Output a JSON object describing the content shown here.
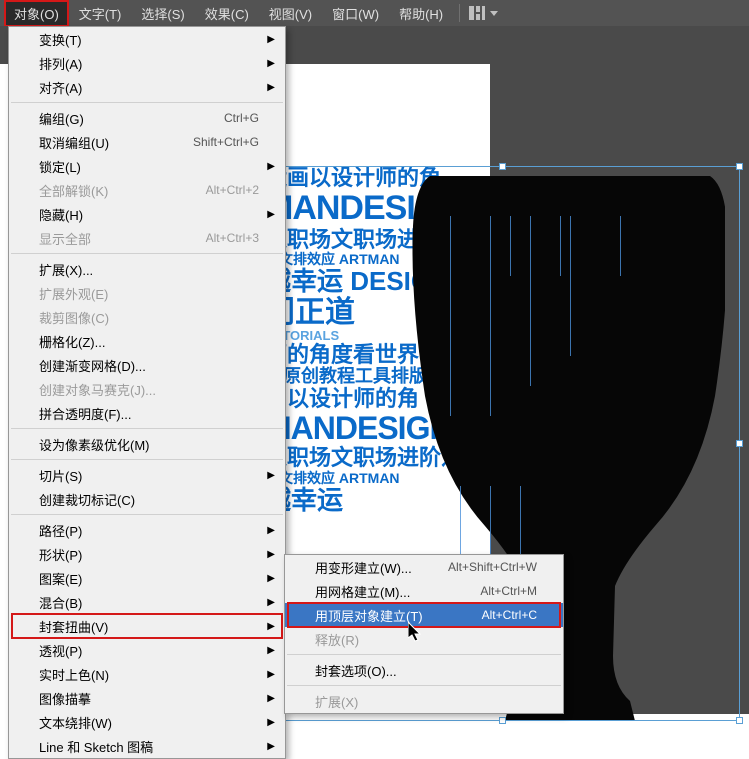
{
  "menubar": {
    "items": [
      "对象(O)",
      "文字(T)",
      "选择(S)",
      "效果(C)",
      "视图(V)",
      "窗口(W)",
      "帮助(H)"
    ]
  },
  "dropdown": {
    "groups": [
      [
        {
          "label": "变换(T)",
          "arrow": true
        },
        {
          "label": "排列(A)",
          "arrow": true
        },
        {
          "label": "对齐(A)",
          "arrow": true
        }
      ],
      [
        {
          "label": "编组(G)",
          "shortcut": "Ctrl+G"
        },
        {
          "label": "取消编组(U)",
          "shortcut": "Shift+Ctrl+G"
        },
        {
          "label": "锁定(L)",
          "arrow": true
        },
        {
          "label": "全部解锁(K)",
          "shortcut": "Alt+Ctrl+2",
          "disabled": true
        },
        {
          "label": "隐藏(H)",
          "arrow": true
        },
        {
          "label": "显示全部",
          "shortcut": "Alt+Ctrl+3",
          "disabled": true
        }
      ],
      [
        {
          "label": "扩展(X)..."
        },
        {
          "label": "扩展外观(E)",
          "disabled": true
        },
        {
          "label": "裁剪图像(C)",
          "disabled": true
        },
        {
          "label": "栅格化(Z)..."
        },
        {
          "label": "创建渐变网格(D)..."
        },
        {
          "label": "创建对象马赛克(J)...",
          "disabled": true
        },
        {
          "label": "拼合透明度(F)..."
        }
      ],
      [
        {
          "label": "设为像素级优化(M)"
        }
      ],
      [
        {
          "label": "切片(S)",
          "arrow": true
        },
        {
          "label": "创建裁切标记(C)"
        }
      ],
      [
        {
          "label": "路径(P)",
          "arrow": true
        },
        {
          "label": "形状(P)",
          "arrow": true
        },
        {
          "label": "图案(E)",
          "arrow": true
        },
        {
          "label": "混合(B)",
          "arrow": true
        },
        {
          "label": "封套扭曲(V)",
          "arrow": true,
          "boxed": true
        },
        {
          "label": "透视(P)",
          "arrow": true
        },
        {
          "label": "实时上色(N)",
          "arrow": true
        },
        {
          "label": "图像描摹",
          "arrow": true
        },
        {
          "label": "文本绕排(W)",
          "arrow": true
        },
        {
          "label": "Line 和 Sketch 图稿",
          "arrow": true
        }
      ]
    ]
  },
  "submenu": {
    "items": [
      {
        "label": "用变形建立(W)...",
        "shortcut": "Alt+Shift+Ctrl+W"
      },
      {
        "label": "用网格建立(M)...",
        "shortcut": "Alt+Ctrl+M"
      },
      {
        "label": "用顶层对象建立(T)",
        "shortcut": "Alt+Ctrl+C",
        "highlighted": true,
        "boxed": true
      },
      {
        "label": "释放(R)",
        "disabled": true
      },
      {
        "sep": true
      },
      {
        "label": "封套选项(O)..."
      },
      {
        "sep": true
      },
      {
        "label": "扩展(X)",
        "disabled": true
      }
    ]
  },
  "canvas_text": {
    "l1": "运画以设计师的角",
    "l2": "MANDESI",
    "l3": "入职场文职场进阶",
    "l4": "版文排效应 ARTMAN",
    "l5": "越幸运 DESIGN",
    "l6": "门正道",
    "l7": "TUTORIALS",
    "l8": "师的角度看世界",
    "l9": "运原创教程工具排版",
    "l10": "画以设计师的角",
    "l11": "MANDESIGN",
    "l12": "入职场文职场进阶之",
    "l13": "版文排效应 ARTMAN",
    "l14": "越幸运"
  }
}
